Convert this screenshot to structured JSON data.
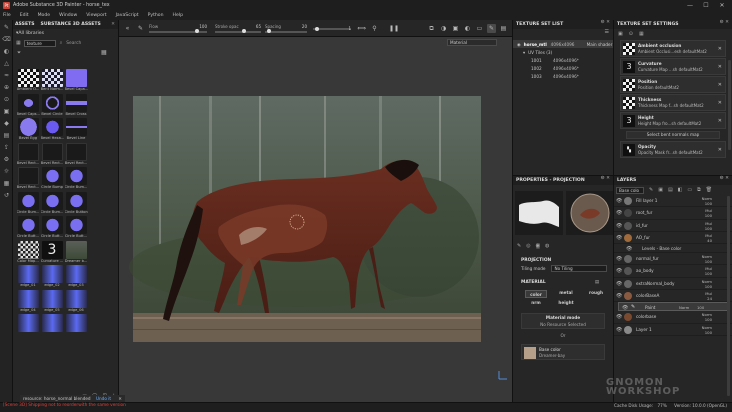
{
  "window": {
    "title": "Adobe Substance 3D Painter - horse_tex",
    "minimize": "—",
    "maximize": "☐",
    "close": "✕"
  },
  "menu": [
    "File",
    "Edit",
    "Mode",
    "Window",
    "Viewport",
    "JavaScript",
    "Python",
    "Help"
  ],
  "toolbar": {
    "flow": {
      "label": "Flow",
      "value": "100"
    },
    "stroke_opacity": {
      "label": "Stroke opac",
      "value": "65"
    },
    "spacing": {
      "label": "Spacing",
      "value": "20"
    },
    "extra_value": "1"
  },
  "viewport": {
    "dropdown": "Material"
  },
  "assets": {
    "tabs": [
      "ASSETS",
      "SUBSTANCE 3D ASSETS"
    ],
    "library": "All libraries",
    "filter": "texture",
    "search_placeholder": "Search",
    "items": [
      {
        "label": "Ambient O...",
        "style": "checker"
      },
      {
        "label": "Bent Norm...",
        "style": "checker2"
      },
      {
        "label": "Bevel Capa...",
        "style": "purple"
      },
      {
        "label": "",
        "style": "empty"
      },
      {
        "label": "Bevel Caps...",
        "style": "bar"
      },
      {
        "label": "Bevel Circle",
        "style": "ring"
      },
      {
        "label": "Bevel Cross",
        "style": "cross"
      },
      {
        "label": "",
        "style": "empty"
      },
      {
        "label": "Bevel Egg",
        "style": "egg"
      },
      {
        "label": "Bevel Hexa...",
        "style": "hex"
      },
      {
        "label": "Bevel Line",
        "style": "line"
      },
      {
        "label": "",
        "style": "empty"
      },
      {
        "label": "Bevel Rect...",
        "style": "dark"
      },
      {
        "label": "Bevel Rect...",
        "style": "dark"
      },
      {
        "label": "Bevel Rect...",
        "style": "dark"
      },
      {
        "label": "",
        "style": "empty"
      },
      {
        "label": "Bevel Rect...",
        "style": "dark"
      },
      {
        "label": "Circle Bump",
        "style": "circle"
      },
      {
        "label": "Circle Bum...",
        "style": "circle"
      },
      {
        "label": "",
        "style": "empty"
      },
      {
        "label": "Circle Bum...",
        "style": "circle"
      },
      {
        "label": "Circle Bum...",
        "style": "circle"
      },
      {
        "label": "Circle Button",
        "style": "circle"
      },
      {
        "label": "",
        "style": "empty"
      },
      {
        "label": "Circle Butt...",
        "style": "circle"
      },
      {
        "label": "Circle Butt...",
        "style": "circle"
      },
      {
        "label": "Circle Butt...",
        "style": "circle"
      },
      {
        "label": "",
        "style": "empty"
      },
      {
        "label": "Color Map...",
        "style": "checker3"
      },
      {
        "label": "Curvature ...",
        "style": "three"
      },
      {
        "label": "Dreamer b...",
        "style": "photo"
      },
      {
        "label": "",
        "style": "empty"
      },
      {
        "label": "edge_01",
        "style": "edge"
      },
      {
        "label": "edge_02",
        "style": "edge"
      },
      {
        "label": "edge_03",
        "style": "edge"
      },
      {
        "label": "",
        "style": "empty"
      },
      {
        "label": "edge_04",
        "style": "edge"
      },
      {
        "label": "edge_05",
        "style": "edge"
      },
      {
        "label": "edge_06",
        "style": "edge"
      },
      {
        "label": "",
        "style": "empty"
      },
      {
        "label": "",
        "style": "edge"
      },
      {
        "label": "",
        "style": "edge"
      },
      {
        "label": "",
        "style": "edge"
      }
    ]
  },
  "texture_set_list": {
    "title": "TEXTURE SET LIST",
    "main": {
      "name": "horse_mtl",
      "res": "4096x4096",
      "shader": "Main shader"
    },
    "uv_header": "UV Tiles (3)",
    "tiles": [
      {
        "name": "1001",
        "res": "4096x4096*"
      },
      {
        "name": "1002",
        "res": "4096x4096*"
      },
      {
        "name": "1003",
        "res": "4096x4096*"
      }
    ]
  },
  "texture_set_settings": {
    "title": "TEXTURE SET SETTINGS",
    "channels": [
      {
        "name": "Ambient occlusion",
        "sub": "Ambient Occlusi...esh defaultMat2",
        "icon": "checker"
      },
      {
        "name": "Curvature",
        "sub": "Curvature Map ...sh defaultMat2",
        "icon": "three"
      },
      {
        "name": "Position",
        "sub": "Position defaultMat2",
        "icon": "checker"
      },
      {
        "name": "Thickness",
        "sub": "Thickness Map f...sh defaultMat2",
        "icon": "checker"
      },
      {
        "name": "Height",
        "sub": "Height Map fro...sh defaultMat2",
        "icon": "three"
      }
    ],
    "select_btn": "Select bent normals map",
    "opacity": {
      "name": "Opacity",
      "sub": "Opacity Mask fr...sh defaultMat2"
    }
  },
  "properties": {
    "title": "PROPERTIES - PROJECTION",
    "projection_header": "PROJECTION",
    "tiling_label": "Tiling mode",
    "tiling_value": "No Tiling",
    "material_header": "MATERIAL",
    "material_channels": [
      "color",
      "metal",
      "rough",
      "nrm",
      "height",
      ""
    ],
    "material_mode_title": "Material mode",
    "material_mode_value": "No Resource Selected",
    "or": "Or",
    "base_color": {
      "name": "Base color",
      "sub": "Dreamer-bay"
    }
  },
  "layers": {
    "title": "LAYERS",
    "blend_dropdown": "Base colo",
    "rows": [
      {
        "name": "Fill layer 1",
        "blend": "Norm",
        "op": "100",
        "type": "layer",
        "thumb": "#777"
      },
      {
        "name": "root_fur",
        "blend": "Mul",
        "op": "100",
        "type": "layer",
        "thumb": "#444"
      },
      {
        "name": "id_fur",
        "blend": "Mul",
        "op": "100",
        "type": "layer",
        "thumb": "#555"
      },
      {
        "name": "AO_fur",
        "blend": "Mul",
        "op": "40",
        "type": "layer",
        "thumb": "#a06a3a"
      },
      {
        "name": "Levels - Base color",
        "blend": "",
        "op": "",
        "type": "sub",
        "thumb": ""
      },
      {
        "name": "normal_fur",
        "blend": "Norm",
        "op": "100",
        "type": "layer",
        "thumb": "#666"
      },
      {
        "name": "ao_body",
        "blend": "Mul",
        "op": "100",
        "type": "layer",
        "thumb": "#555"
      },
      {
        "name": "extraNormal_body",
        "blend": "Norm",
        "op": "100",
        "type": "layer",
        "thumb": "#666"
      },
      {
        "name": "colorBaseA",
        "blend": "Mul",
        "op": "24",
        "type": "layer",
        "thumb": "#8a5a40"
      },
      {
        "name": "Paint",
        "blend": "Norm",
        "op": "100",
        "type": "sel",
        "thumb": ""
      },
      {
        "name": "colorbase",
        "blend": "Norm",
        "op": "100",
        "type": "layer",
        "thumb": "#7a4a30"
      },
      {
        "name": "Layer 1",
        "blend": "Norm",
        "op": "100",
        "type": "layer",
        "thumb": "#8a8a8a"
      }
    ]
  },
  "status": {
    "warning": "[Scene 3D] Shipping not to reorderwith the same version",
    "message": "resource: horse_normal blended",
    "undo": "Undo it",
    "cache": "Cache Disk Usage:",
    "percent": "77%",
    "version": "Version: 10.0.0 (OpenGL)"
  },
  "watermark": "GNOMON WORKSHOP"
}
